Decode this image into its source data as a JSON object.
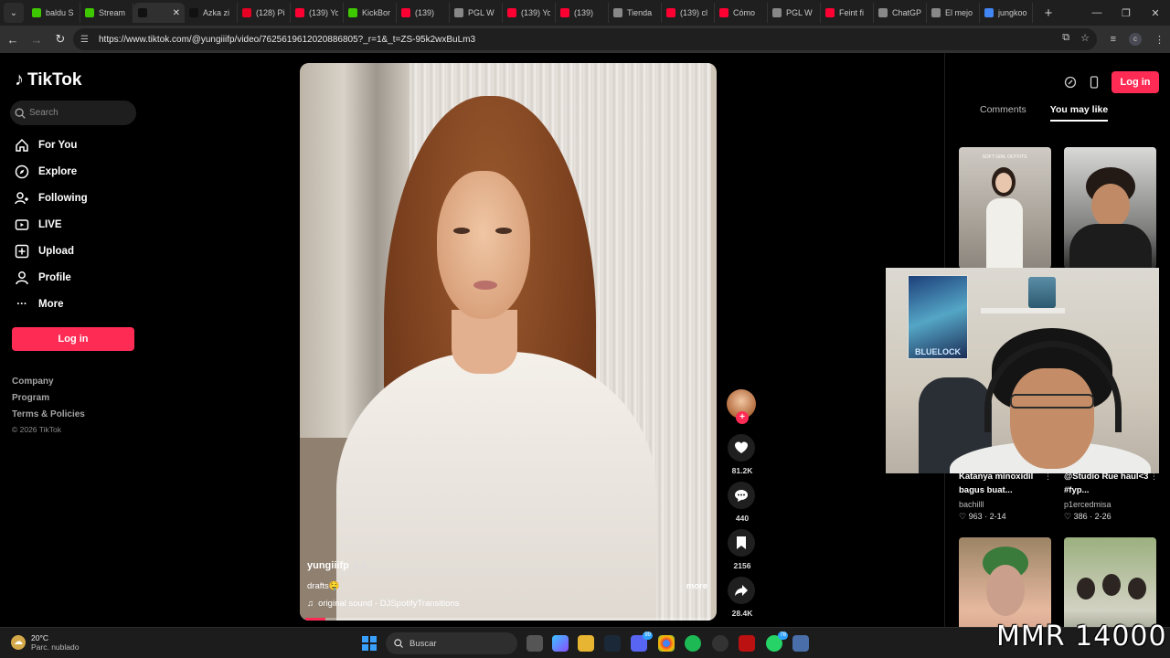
{
  "browser": {
    "tabs": [
      {
        "label": "baldu S",
        "color": "#3ec800"
      },
      {
        "label": "Stream",
        "color": "#3ec800"
      },
      {
        "label": "",
        "color": "#111111",
        "active": true
      },
      {
        "label": "Azka zi",
        "color": "#111111"
      },
      {
        "label": "(128) Pi",
        "color": "#e60023"
      },
      {
        "label": "(139) Yo",
        "color": "#ff0033"
      },
      {
        "label": "KickBor",
        "color": "#3ec800"
      },
      {
        "label": "(139)",
        "color": "#ff0033"
      },
      {
        "label": "PGL W",
        "color": "#888888"
      },
      {
        "label": "(139) Yo",
        "color": "#ff0033"
      },
      {
        "label": "(139)",
        "color": "#ff0033"
      },
      {
        "label": "Tienda",
        "color": "#888888"
      },
      {
        "label": "(139) cl",
        "color": "#ff0033"
      },
      {
        "label": "Cómo",
        "color": "#ff0033"
      },
      {
        "label": "PGL W",
        "color": "#888888"
      },
      {
        "label": "Feint fi",
        "color": "#ff0033"
      },
      {
        "label": "ChatGP",
        "color": "#888888"
      },
      {
        "label": "El mejo",
        "color": "#888888"
      },
      {
        "label": "jungkoo",
        "color": "#4285f4"
      }
    ],
    "url": "https://www.tiktok.com/@yungiiifp/video/7625619612020886805?_r=1&_t=ZS-95k2wxBuLm3"
  },
  "sidebar": {
    "brand": "TikTok",
    "search_placeholder": "Search",
    "nav": [
      {
        "label": "For You",
        "icon": "home-icon"
      },
      {
        "label": "Explore",
        "icon": "compass-icon"
      },
      {
        "label": "Following",
        "icon": "following-icon"
      },
      {
        "label": "LIVE",
        "icon": "live-icon"
      },
      {
        "label": "Upload",
        "icon": "upload-icon"
      },
      {
        "label": "Profile",
        "icon": "profile-icon"
      },
      {
        "label": "More",
        "icon": "more-icon"
      }
    ],
    "login_label": "Log in",
    "footer": [
      "Company",
      "Program",
      "Terms & Policies"
    ],
    "copyright": "© 2026 TikTok"
  },
  "video": {
    "username": "yungiiifp",
    "time": "4-6",
    "caption": "drafts🤤",
    "sound": "original sound - DJSpotifyTransitions",
    "more_label": "more",
    "progress": 0.05
  },
  "actions": {
    "likes": "81.2K",
    "comments": "440",
    "saves": "2156",
    "shares": "28.4K"
  },
  "right_panel": {
    "login_label": "Log in",
    "tabs": [
      "Comments",
      "You may like"
    ],
    "cards": [
      {
        "title": "Katanya minoxidil bagus buat...",
        "author": "bachilll",
        "likes": "963",
        "date": "2-14"
      },
      {
        "title": "@Studio Rue haul<3 #fyp...",
        "author": "p1ercedmisa",
        "likes": "386",
        "date": "2-26"
      }
    ],
    "thumb_caption": "SOFT GIRL OUTFITS"
  },
  "webcam": {
    "poster_text": "BLUELOCK"
  },
  "taskbar": {
    "temp": "20°C",
    "weather": "Parc. nublado",
    "search_label": "Buscar",
    "badge_discord": "99",
    "badge_whatsapp": "78"
  },
  "overlay": {
    "mmr": "MMR 14000"
  },
  "colors": {
    "accent": "#fe2c55",
    "background": "#000000"
  }
}
